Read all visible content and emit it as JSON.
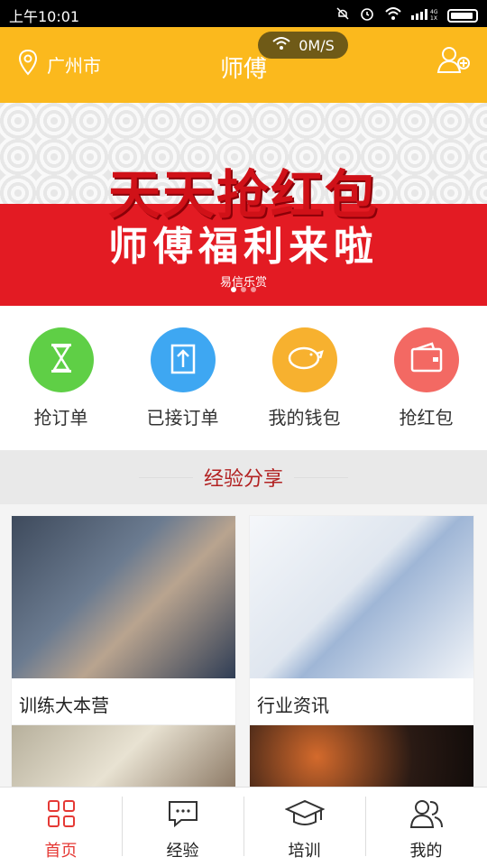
{
  "status": {
    "time": "上午10:01"
  },
  "header": {
    "location": "广州市",
    "title": "师傅",
    "speed": "0M/S"
  },
  "banner": {
    "headline": "天天抢红包",
    "subtitle": "师傅福利来啦",
    "logo_text": "易信乐赏"
  },
  "quick_actions": [
    {
      "label": "抢订单",
      "color": "#5fcf46",
      "icon": "hourglass-icon"
    },
    {
      "label": "已接订单",
      "color": "#3ea7f2",
      "icon": "upload-icon"
    },
    {
      "label": "我的钱包",
      "color": "#f7b12f",
      "icon": "piggy-bank-icon"
    },
    {
      "label": "抢红包",
      "color": "#f36963",
      "icon": "wallet-icon"
    }
  ],
  "section": {
    "title": "经验分享"
  },
  "cards": [
    {
      "label": "训练大本营"
    },
    {
      "label": "行业资讯"
    },
    {
      "label": ""
    },
    {
      "label": ""
    }
  ],
  "tabs": [
    {
      "label": "首页",
      "icon": "home-grid-icon",
      "active": true
    },
    {
      "label": "经验",
      "icon": "chat-icon",
      "active": false
    },
    {
      "label": "培训",
      "icon": "graduation-cap-icon",
      "active": false
    },
    {
      "label": "我的",
      "icon": "users-icon",
      "active": false
    }
  ]
}
